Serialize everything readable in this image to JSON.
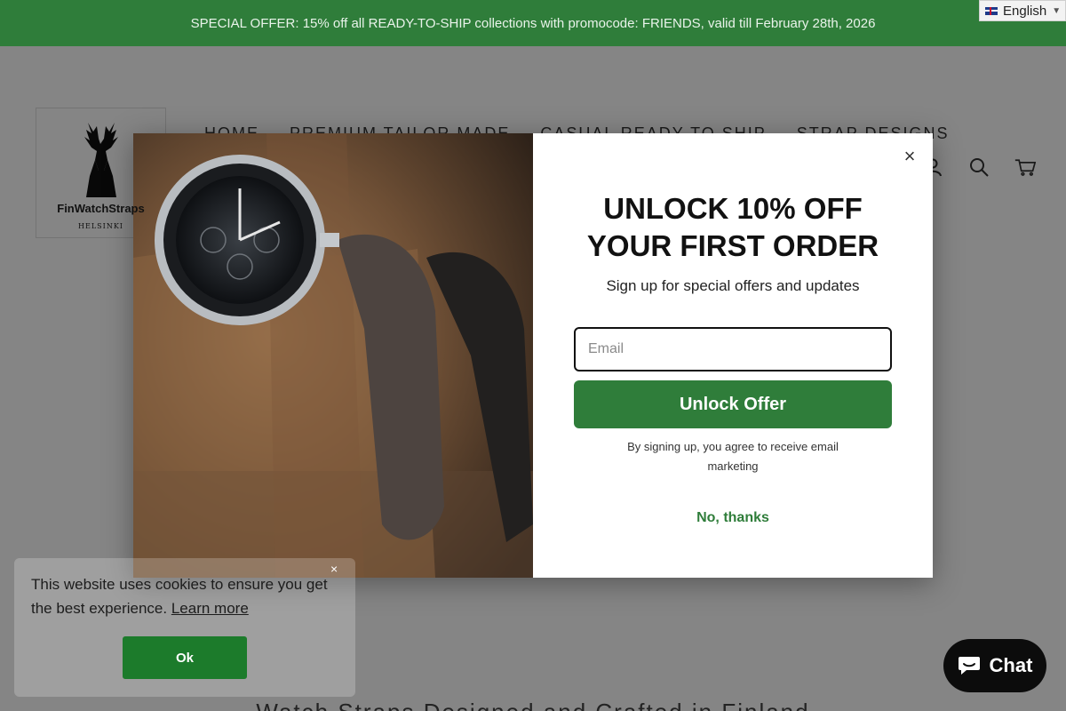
{
  "announcement": {
    "text": "SPECIAL OFFER: 15% off all READY-TO-SHIP collections with promocode: FRIENDS, valid till February 28th, 2026"
  },
  "language": {
    "selected": "English"
  },
  "logo": {
    "name": "FinWatchStraps",
    "location": "HELSINKI"
  },
  "nav": {
    "items": [
      "HOME",
      "PREMIUM TAILOR MADE",
      "CASUAL READY TO SHIP",
      "STRAP DESIGNS"
    ]
  },
  "header_icons": {
    "account": "LOG IN",
    "search": "SEARCH",
    "cart": "CART"
  },
  "popup": {
    "headline_line1": "UNLOCK 10% OFF",
    "headline_line2": "YOUR FIRST ORDER",
    "subhead": "Sign up for special offers and updates",
    "email_placeholder": "Email",
    "unlock_label": "Unlock Offer",
    "consent": "By signing up, you agree to receive email marketing",
    "no_thanks": "No, thanks",
    "close": "×"
  },
  "cookie": {
    "text": "This website uses cookies to ensure you get the best experience.",
    "link": "Learn more",
    "ok": "Ok",
    "close": "×"
  },
  "tagline": "Watch Straps Designed and Crafted in Finland",
  "chat": {
    "label": "Chat"
  },
  "colors": {
    "brand_green": "#2f7d3a",
    "chat_black": "#0c0c0c"
  }
}
